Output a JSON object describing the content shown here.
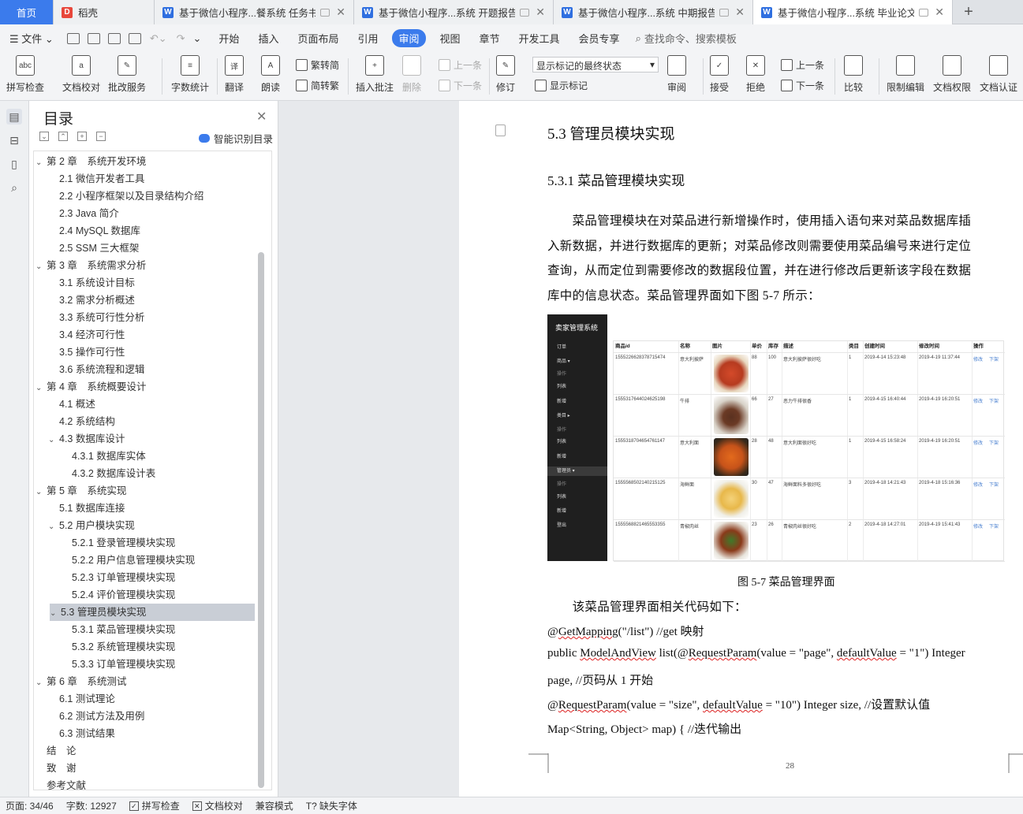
{
  "tabs": [
    {
      "label": "首页",
      "kind": "home"
    },
    {
      "label": "稻壳",
      "kind": "daoke"
    },
    {
      "label": "基于微信小程序...餐系统 任务书",
      "kind": "doc"
    },
    {
      "label": "基于微信小程序...系统 开题报告",
      "kind": "doc"
    },
    {
      "label": "基于微信小程序...系统 中期报告",
      "kind": "doc"
    },
    {
      "label": "基于微信小程序...系统 毕业论文",
      "kind": "doc",
      "active": true
    }
  ],
  "menu": {
    "file": "文件",
    "items": [
      "开始",
      "插入",
      "页面布局",
      "引用",
      "审阅",
      "视图",
      "章节",
      "开发工具",
      "会员专享"
    ],
    "selected": "审阅",
    "search": "查找命令、搜索模板"
  },
  "ribbon": {
    "spell": "拼写检查",
    "doc_check": "文档校对",
    "batch": "批改服务",
    "word_count": "字数统计",
    "translate": "翻译",
    "read_aloud": "朗读",
    "trad": "繁转简",
    "simp": "简转繁",
    "insert_comment": "插入批注",
    "delete": "删除",
    "prev": "上一条",
    "next": "下一条",
    "revise": "修订",
    "markup_dropdown": "显示标记的最终状态",
    "show_markup": "显示标记",
    "review": "审阅",
    "accept": "接受",
    "reject": "拒绝",
    "prev2": "上一条",
    "next2": "下一条",
    "compare": "比较",
    "restrict": "限制编辑",
    "doc_rights": "文档权限",
    "doc_cert": "文档认证"
  },
  "toc": {
    "title": "目录",
    "smart": "智能识别目录",
    "items": [
      {
        "label": "第 2 章　系统开发环境",
        "level": 1,
        "arrow": "expanded"
      },
      {
        "label": "2.1 微信开发者工具",
        "level": 2
      },
      {
        "label": "2.2 小程序框架以及目录结构介绍",
        "level": 2
      },
      {
        "label": "2.3 Java 简介",
        "level": 2
      },
      {
        "label": "2.4 MySQL 数据库",
        "level": 2
      },
      {
        "label": "2.5 SSM 三大框架",
        "level": 2
      },
      {
        "label": "第 3 章　系统需求分析",
        "level": 1,
        "arrow": "expanded"
      },
      {
        "label": "3.1  系统设计目标",
        "level": 2
      },
      {
        "label": "3.2 需求分析概述",
        "level": 2
      },
      {
        "label": "3.3  系统可行性分析",
        "level": 2
      },
      {
        "label": "3.4 经济可行性",
        "level": 2
      },
      {
        "label": "3.5 操作可行性",
        "level": 2
      },
      {
        "label": "3.6 系统流程和逻辑",
        "level": 2
      },
      {
        "label": "第 4 章　系统概要设计",
        "level": 1,
        "arrow": "expanded"
      },
      {
        "label": "4.1  概述",
        "level": 2
      },
      {
        "label": "4.2  系统结构",
        "level": 2
      },
      {
        "label": "4.3  数据库设计",
        "level": 2,
        "arrow": "expanded"
      },
      {
        "label": "4.3.1  数据库实体",
        "level": 3
      },
      {
        "label": "4.3.2  数据库设计表",
        "level": 3
      },
      {
        "label": "第 5 章　系统实现",
        "level": 1,
        "arrow": "expanded"
      },
      {
        "label": "5.1 数据库连接",
        "level": 2
      },
      {
        "label": "5.2 用户模块实现",
        "level": 2,
        "arrow": "expanded"
      },
      {
        "label": "5.2.1  登录管理模块实现",
        "level": 3
      },
      {
        "label": "5.2.2  用户信息管理模块实现",
        "level": 3
      },
      {
        "label": "5.2.3  订单管理模块实现",
        "level": 3
      },
      {
        "label": "5.2.4  评价管理模块实现",
        "level": 3
      },
      {
        "label": "5.3  管理员模块实现",
        "level": 2,
        "arrow": "expanded",
        "selected": true
      },
      {
        "label": "5.3.1  菜品管理模块实现",
        "level": 3
      },
      {
        "label": "5.3.2  系统管理模块实现",
        "level": 3
      },
      {
        "label": "5.3.3  订单管理模块实现",
        "level": 3
      },
      {
        "label": "第 6 章　系统测试",
        "level": 1,
        "arrow": "expanded"
      },
      {
        "label": "6.1  测试理论",
        "level": 2
      },
      {
        "label": "6.2  测试方法及用例",
        "level": 2
      },
      {
        "label": "6.3 测试结果",
        "level": 2
      },
      {
        "label": "结　论",
        "level": 1
      },
      {
        "label": "致　谢",
        "level": 1
      },
      {
        "label": "参考文献",
        "level": 1
      }
    ]
  },
  "doc": {
    "h2": "5.3  管理员模块实现",
    "h3": "5.3.1  菜品管理模块实现",
    "para_lines": [
      "　　菜品管理模块在对菜品进行新增操作时，使用插入语句来对菜品数据库插",
      "入新数据，并进行数据库的更新；对菜品修改则需要使用菜品编号来进行定位",
      "查询，从而定位到需要修改的数据段位置，并在进行修改后更新该字段在数据",
      "库中的信息状态。菜品管理界面如下图 5-7 所示："
    ],
    "caption": "图 5-7  菜品管理界面",
    "after_caption": "　　该菜品管理界面相关代码如下：",
    "code": {
      "l1_a": "GetMapping",
      "l1_b": "(\"/list\")     //get 映射",
      "l2_a": "public ",
      "l2_b": "ModelAndView",
      "l2_c": " list(@",
      "l2_d": "RequestParam",
      "l2_e": "(value = \"page\", ",
      "l2_f": "defaultValue",
      "l2_g": " = \"1\") Integer",
      "l3": "page,    //页码从 1 开始",
      "l4_a": "RequestParam",
      "l4_b": "(value = \"size\", ",
      "l4_c": "defaultValue",
      "l4_d": " = \"10\") Integer size,    //设置默认值",
      "l5": "Map<String, Object> map) {    //迭代输出"
    },
    "page_number": "28"
  },
  "figure": {
    "title": "卖家管理系统",
    "sidebar": [
      {
        "label": "订单",
        "kind": "item"
      },
      {
        "label": "商品 ▾",
        "kind": "item"
      },
      {
        "label": "操作",
        "kind": "grp"
      },
      {
        "label": "列表",
        "kind": "item"
      },
      {
        "label": "新增",
        "kind": "item"
      },
      {
        "label": "类目 ▸",
        "kind": "item"
      },
      {
        "label": "操作",
        "kind": "grp"
      },
      {
        "label": "列表",
        "kind": "item"
      },
      {
        "label": "新增",
        "kind": "item"
      },
      {
        "label": "管理员 ▾",
        "kind": "hl"
      },
      {
        "label": "操作",
        "kind": "grp"
      },
      {
        "label": "列表",
        "kind": "item"
      },
      {
        "label": "新增",
        "kind": "item"
      },
      {
        "label": "登出",
        "kind": "item"
      }
    ],
    "headers": [
      "商品id",
      "名称",
      "图片",
      "单价",
      "库存",
      "描述",
      "类目",
      "创建时间",
      "修改时间",
      "操作"
    ],
    "rows": [
      [
        "1555226628378715474",
        "意大利披萨",
        "",
        "88",
        "100",
        "意大利披萨很好吃",
        "1",
        "2019-4-14 15:23:48",
        "2019-4-19 11:37:44",
        "修改",
        "下架"
      ],
      [
        "1555317644024625198",
        "牛排",
        "",
        "66",
        "27",
        "恶力牛排很香",
        "1",
        "2019-4-15 16:40:44",
        "2019-4-19 16:20:51",
        "修改",
        "下架"
      ],
      [
        "1555318704654761147",
        "意大利面",
        "",
        "28",
        "48",
        "意大利面很好吃",
        "1",
        "2019-4-15 16:58:24",
        "2019-4-19 16:20:51",
        "修改",
        "下架"
      ],
      [
        "1555568502140215125",
        "海鲜面",
        "",
        "30",
        "47",
        "海鲜面料多很好吃",
        "3",
        "2019-4-18 14:21:43",
        "2019-4-18 15:16:36",
        "修改",
        "下架"
      ],
      [
        "1555568821465553355",
        "青椒肉丝",
        "",
        "23",
        "26",
        "青椒肉丝很好吃",
        "2",
        "2019-4-18 14:27:01",
        "2019-4-19 15:41:43",
        "修改",
        "下架"
      ]
    ]
  },
  "status": {
    "page": "页面: 34/46",
    "words": "字数: 12927",
    "spell": "拼写检查",
    "doc_check": "文档校对",
    "compat": "兼容模式",
    "missing_font": "缺失字体"
  }
}
